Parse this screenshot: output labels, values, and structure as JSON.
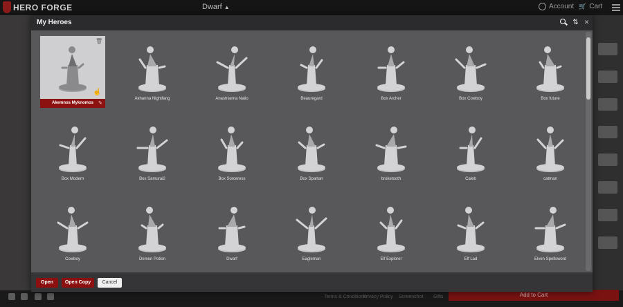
{
  "app": {
    "logo_text": "HERO FORGE",
    "hero_title": "Dwarf",
    "account_label": "Account",
    "cart_label": "Cart",
    "add_to_cart_label": "Add to Cart"
  },
  "footer_links": [
    "Terms & Conditions",
    "Privacy Policy",
    "Screenshot",
    "Gifts"
  ],
  "modal": {
    "title": "My Heroes",
    "icons": [
      "search-icon",
      "sort-icon",
      "close-icon"
    ],
    "buttons": {
      "open": "Open",
      "open_copy": "Open Copy",
      "cancel": "Cancel"
    }
  },
  "heroes": [
    {
      "name": "Akemnos Myknomos",
      "selected": true
    },
    {
      "name": "Akhanna Nightfang"
    },
    {
      "name": "Anastrianna Naiio"
    },
    {
      "name": "Beauregard"
    },
    {
      "name": "Box Archer"
    },
    {
      "name": "Box Cowboy"
    },
    {
      "name": "Box future"
    },
    {
      "name": "Box Modern"
    },
    {
      "name": "Box Samurai2"
    },
    {
      "name": "Box Sorceress"
    },
    {
      "name": "Box Spartan"
    },
    {
      "name": "broketooth"
    },
    {
      "name": "Caleb"
    },
    {
      "name": "catman"
    },
    {
      "name": "Cowboy"
    },
    {
      "name": "Demon Potion"
    },
    {
      "name": "Dwarf"
    },
    {
      "name": "Eagleman"
    },
    {
      "name": "Elf Explorer"
    },
    {
      "name": "Elf Lad"
    },
    {
      "name": "Elven Spellsword"
    }
  ],
  "colors": {
    "accent": "#8c1111",
    "modal_bg": "#58585b",
    "header_bg": "#2b2b2d"
  }
}
